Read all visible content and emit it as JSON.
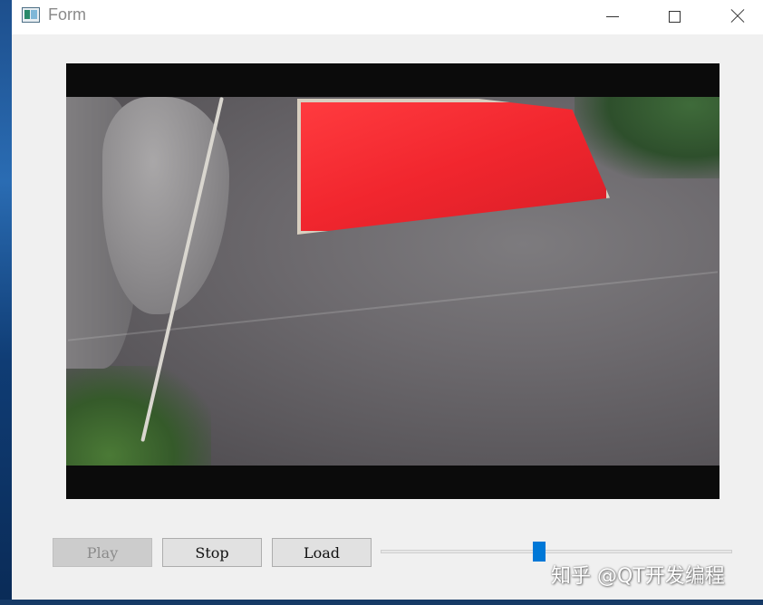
{
  "window": {
    "title": "Form"
  },
  "video": {
    "scene": "elephant-with-red-blanket"
  },
  "controls": {
    "play_label": "Play",
    "play_enabled": false,
    "stop_label": "Stop",
    "load_label": "Load",
    "position_fraction": 0.45
  },
  "watermark": {
    "text": "知乎 @QT开发编程"
  },
  "colors": {
    "slider_accent": "#0078d7",
    "blanket": "#f1262e",
    "video_background": "#0b0b0b"
  }
}
